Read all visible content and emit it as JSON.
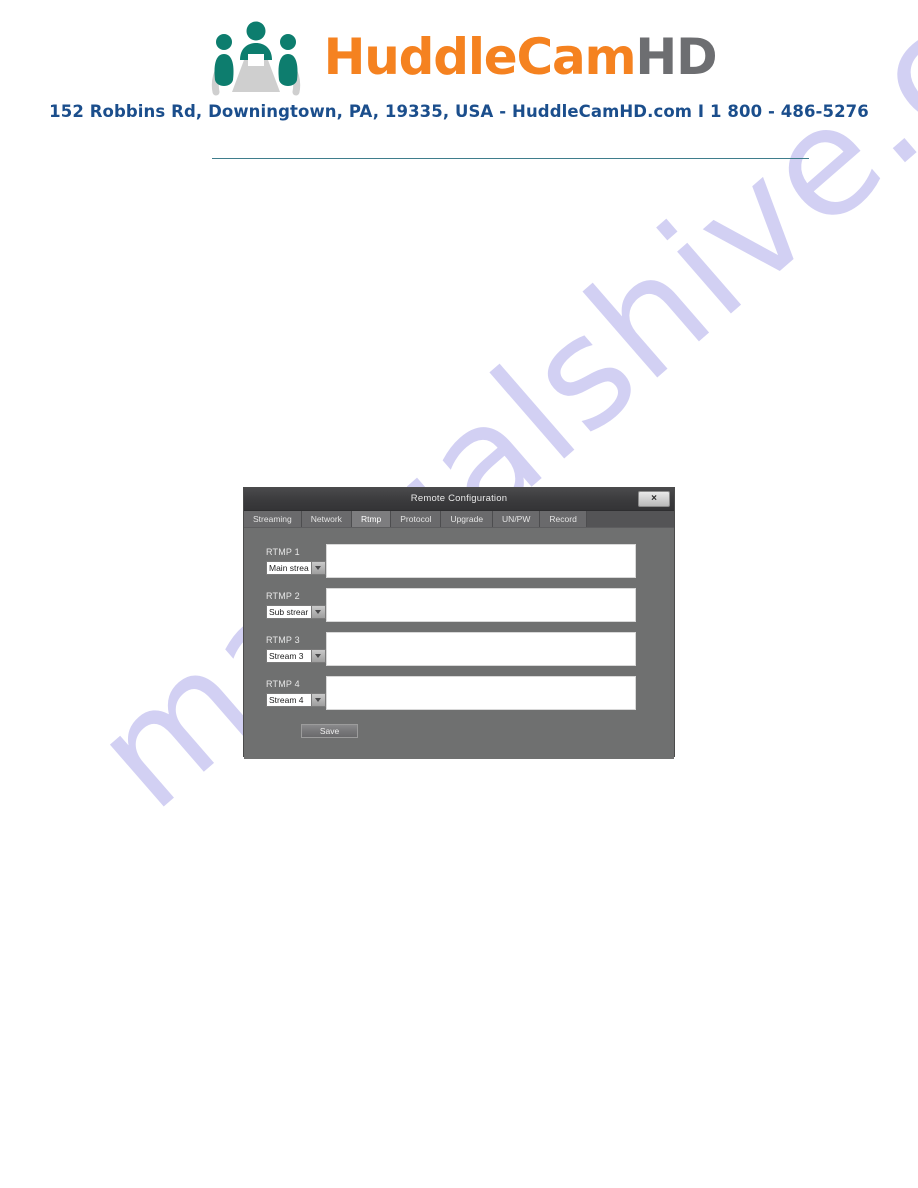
{
  "header": {
    "brand_first": "Huddle",
    "brand_second": "Cam",
    "brand_third": "HD",
    "brand_full": "HuddleCamHD",
    "address": "152 Robbins Rd, Downingtown, PA, 19335, USA - HuddleCamHD.com I 1 800 - 486-5276",
    "logo_icon": "three-people-at-table-icon",
    "colors": {
      "brand_orange": "#f58220",
      "brand_gray": "#6d6e71",
      "address_blue": "#1b4e8c",
      "logo_teal": "#0d7d6e",
      "logo_table_gray": "#cfcfcf",
      "rule": "#3f7d8c"
    }
  },
  "watermark": {
    "text": "manualshive.com",
    "color": "#cfcdf2"
  },
  "dialog": {
    "title": "Remote Configuration",
    "close_label": "×",
    "close_icon": "close-icon",
    "tabs": [
      {
        "label": "Streaming",
        "active": false
      },
      {
        "label": "Network",
        "active": false
      },
      {
        "label": "Rtmp",
        "active": true
      },
      {
        "label": "Protocol",
        "active": false
      },
      {
        "label": "Upgrade",
        "active": false
      },
      {
        "label": "UN/PW",
        "active": false
      },
      {
        "label": "Record",
        "active": false
      }
    ],
    "rows": [
      {
        "label": "RTMP 1",
        "checked": false,
        "stream": "Main strea",
        "url": ""
      },
      {
        "label": "RTMP 2",
        "checked": false,
        "stream": "Sub strear",
        "url": ""
      },
      {
        "label": "RTMP 3",
        "checked": false,
        "stream": "Stream 3",
        "url": ""
      },
      {
        "label": "RTMP 4",
        "checked": false,
        "stream": "Stream 4",
        "url": ""
      }
    ],
    "save_label": "Save",
    "colors": {
      "dialog_bg": "#6f7070",
      "titlebar_bg": "#3b3b3d",
      "tab_bg": "#6a6a6c",
      "tab_active_bg": "#7d7d7f",
      "input_bg": "#ffffff",
      "checkbox_bg": "#4a4a4c"
    }
  }
}
